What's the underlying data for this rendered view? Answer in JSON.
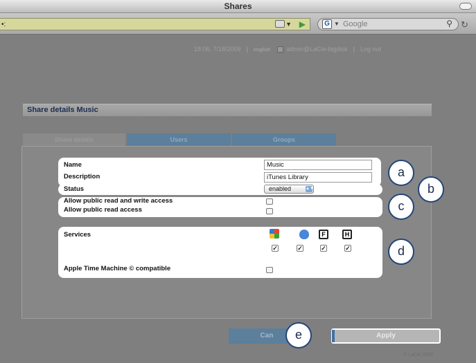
{
  "window": {
    "title": "Shares"
  },
  "toolbar": {
    "url_marker": "•:",
    "search_placeholder": "Google",
    "search_engine_letter": "G"
  },
  "top_info": {
    "datetime": "18:06, 7/18/2009",
    "separator": "|",
    "language": "english",
    "user": "admin@LaCie-bigdisk",
    "logout": "Log out"
  },
  "share": {
    "header": "Share details Music"
  },
  "tabs": [
    "Share details",
    "Users",
    "Groups"
  ],
  "form": {
    "name_label": "Name",
    "name_value": "Music",
    "description_label": "Description",
    "description_value": "iTunes Library",
    "status_label": "Status",
    "status_value": "enabled",
    "public_rw_label": "Allow public read and write access",
    "public_r_label": "Allow public read access",
    "services_label": "Services",
    "services": [
      {
        "name": "windows-icon",
        "checked": true
      },
      {
        "name": "apple-icon",
        "checked": true
      },
      {
        "name": "ftp-icon",
        "letter": "F",
        "checked": true
      },
      {
        "name": "http-icon",
        "letter": "H",
        "checked": true
      }
    ],
    "time_machine_label": "Apple Time Machine © compatible"
  },
  "callouts": [
    "a",
    "b",
    "c",
    "d",
    "e"
  ],
  "buttons": {
    "cancel": "Can",
    "apply": "Apply"
  },
  "footer": {
    "copyright": "© LaCie 2008"
  },
  "colors": {
    "accent": "#21457a",
    "tab_blue": "#5c7f9c",
    "url_bg": "#d6d79a"
  }
}
